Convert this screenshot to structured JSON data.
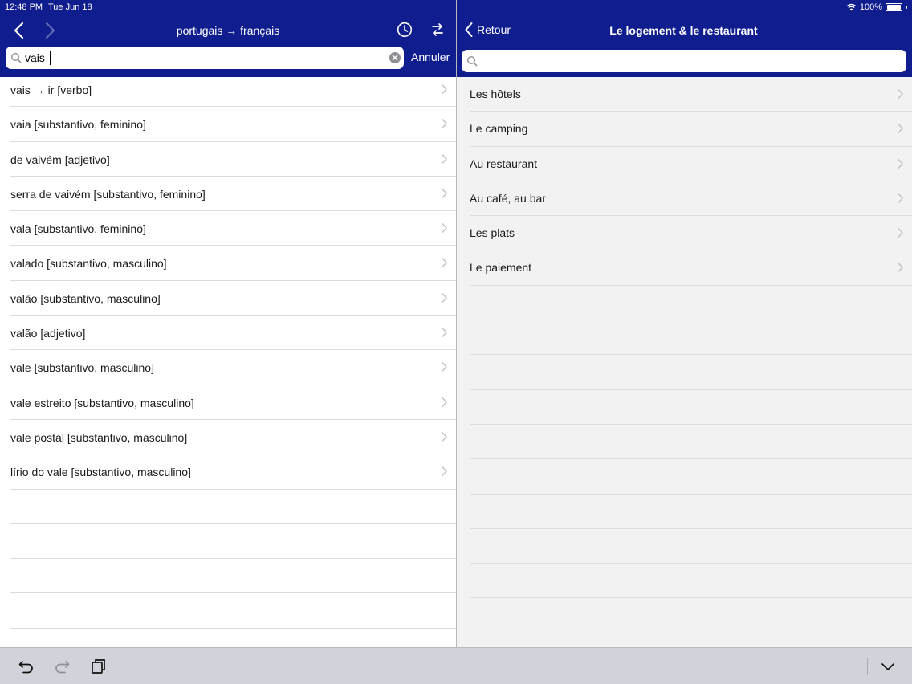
{
  "status_bar": {
    "time": "12:48 PM",
    "date": "Tue Jun 18",
    "battery": "100%"
  },
  "left": {
    "nav_title": "portugais → français",
    "search_value": "vais",
    "cancel_label": "Annuler",
    "results": [
      "vais → ir [verbo]",
      "vaia [substantivo, feminino]",
      "de vaivém [adjetivo]",
      "serra de vaivém [substantivo, feminino]",
      "vala [substantivo, feminino]",
      "valado [substantivo, masculino]",
      "valão [substantivo, masculino]",
      "valão [adjetivo]",
      "vale [substantivo, masculino]",
      "vale estreito [substantivo, masculino]",
      "vale postal [substantivo, masculino]",
      "lírio do vale [substantivo, masculino]"
    ]
  },
  "right": {
    "back_label": "Retour",
    "nav_title": "Le logement & le restaurant",
    "search_placeholder": "",
    "topics": [
      "Les hôtels",
      "Le camping",
      "Au restaurant",
      "Au café, au bar",
      "Les plats",
      "Le paiement"
    ]
  },
  "icons": {
    "back": "chevron-left-icon",
    "forward": "chevron-right-icon",
    "history": "clock-icon",
    "swap": "swap-icon",
    "search": "magnifier-icon",
    "clear": "clear-circle-icon",
    "undo": "undo-icon",
    "redo": "redo-icon",
    "paste": "clipboard-icon",
    "keyboard_dismiss": "chevron-down-icon"
  },
  "colors": {
    "header": "#0f1d8f",
    "toolbar": "#d0d3d9",
    "right_list_bg": "#f2f2f2"
  }
}
